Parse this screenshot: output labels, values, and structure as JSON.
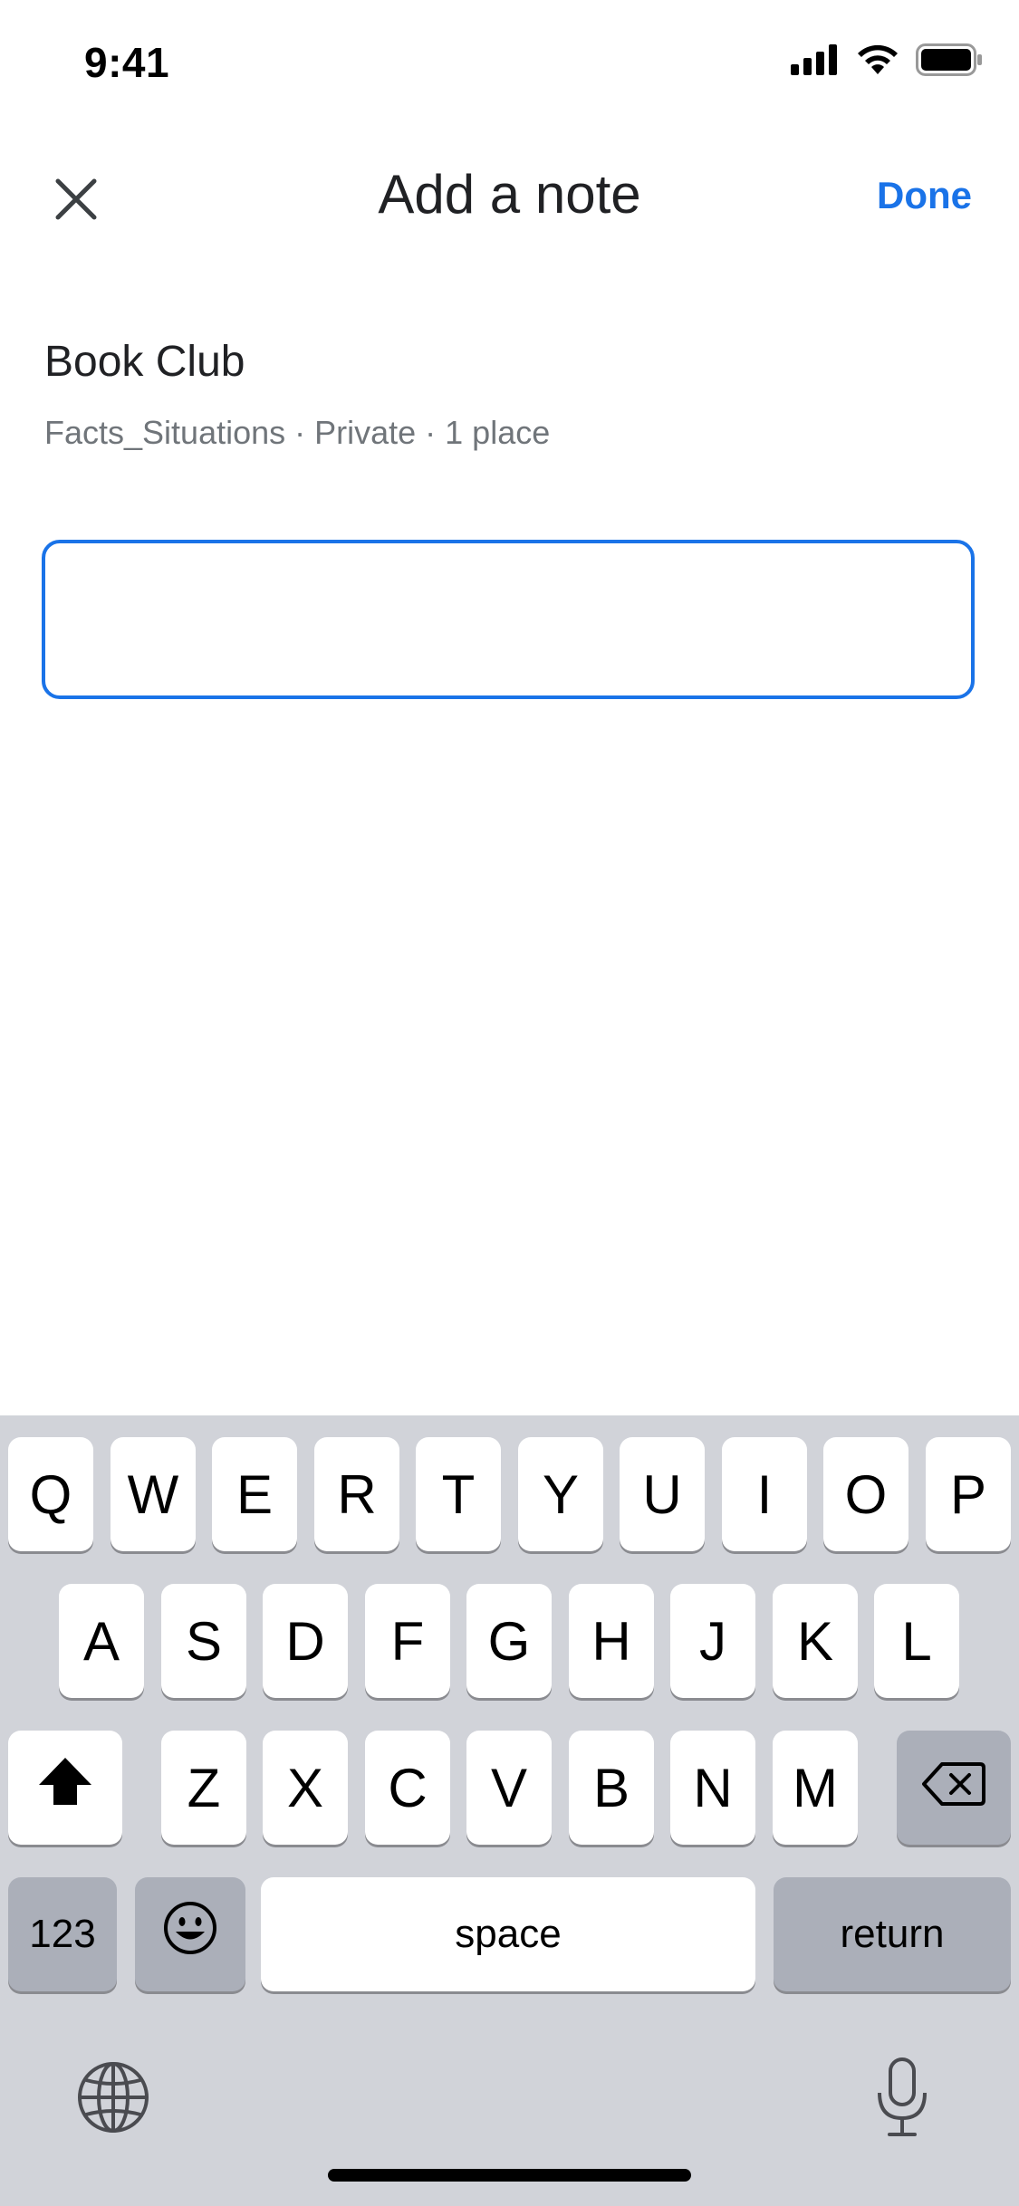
{
  "status_bar": {
    "time": "9:41",
    "icons": [
      "cellular-signal-icon",
      "wifi-icon",
      "battery-icon"
    ]
  },
  "header": {
    "close_icon": "close-icon",
    "title": "Add a note",
    "done_label": "Done"
  },
  "list": {
    "name": "Book Club",
    "meta": "Facts_Situations · Private · 1 place"
  },
  "note_field": {
    "value": "",
    "placeholder": ""
  },
  "keyboard": {
    "row1": [
      "Q",
      "W",
      "E",
      "R",
      "T",
      "Y",
      "U",
      "I",
      "O",
      "P"
    ],
    "row2": [
      "A",
      "S",
      "D",
      "F",
      "G",
      "H",
      "J",
      "K",
      "L"
    ],
    "row3": [
      "Z",
      "X",
      "C",
      "V",
      "B",
      "N",
      "M"
    ],
    "numbers_label": "123",
    "space_label": "space",
    "return_label": "return",
    "shift_icon": "shift-icon",
    "delete_icon": "backspace-icon",
    "emoji_icon": "emoji-icon",
    "globe_icon": "globe-icon",
    "mic_icon": "microphone-icon"
  },
  "colors": {
    "accent": "#1a73e8",
    "keyboard_bg": "#d1d3d9",
    "dark_key": "#abafb9"
  }
}
